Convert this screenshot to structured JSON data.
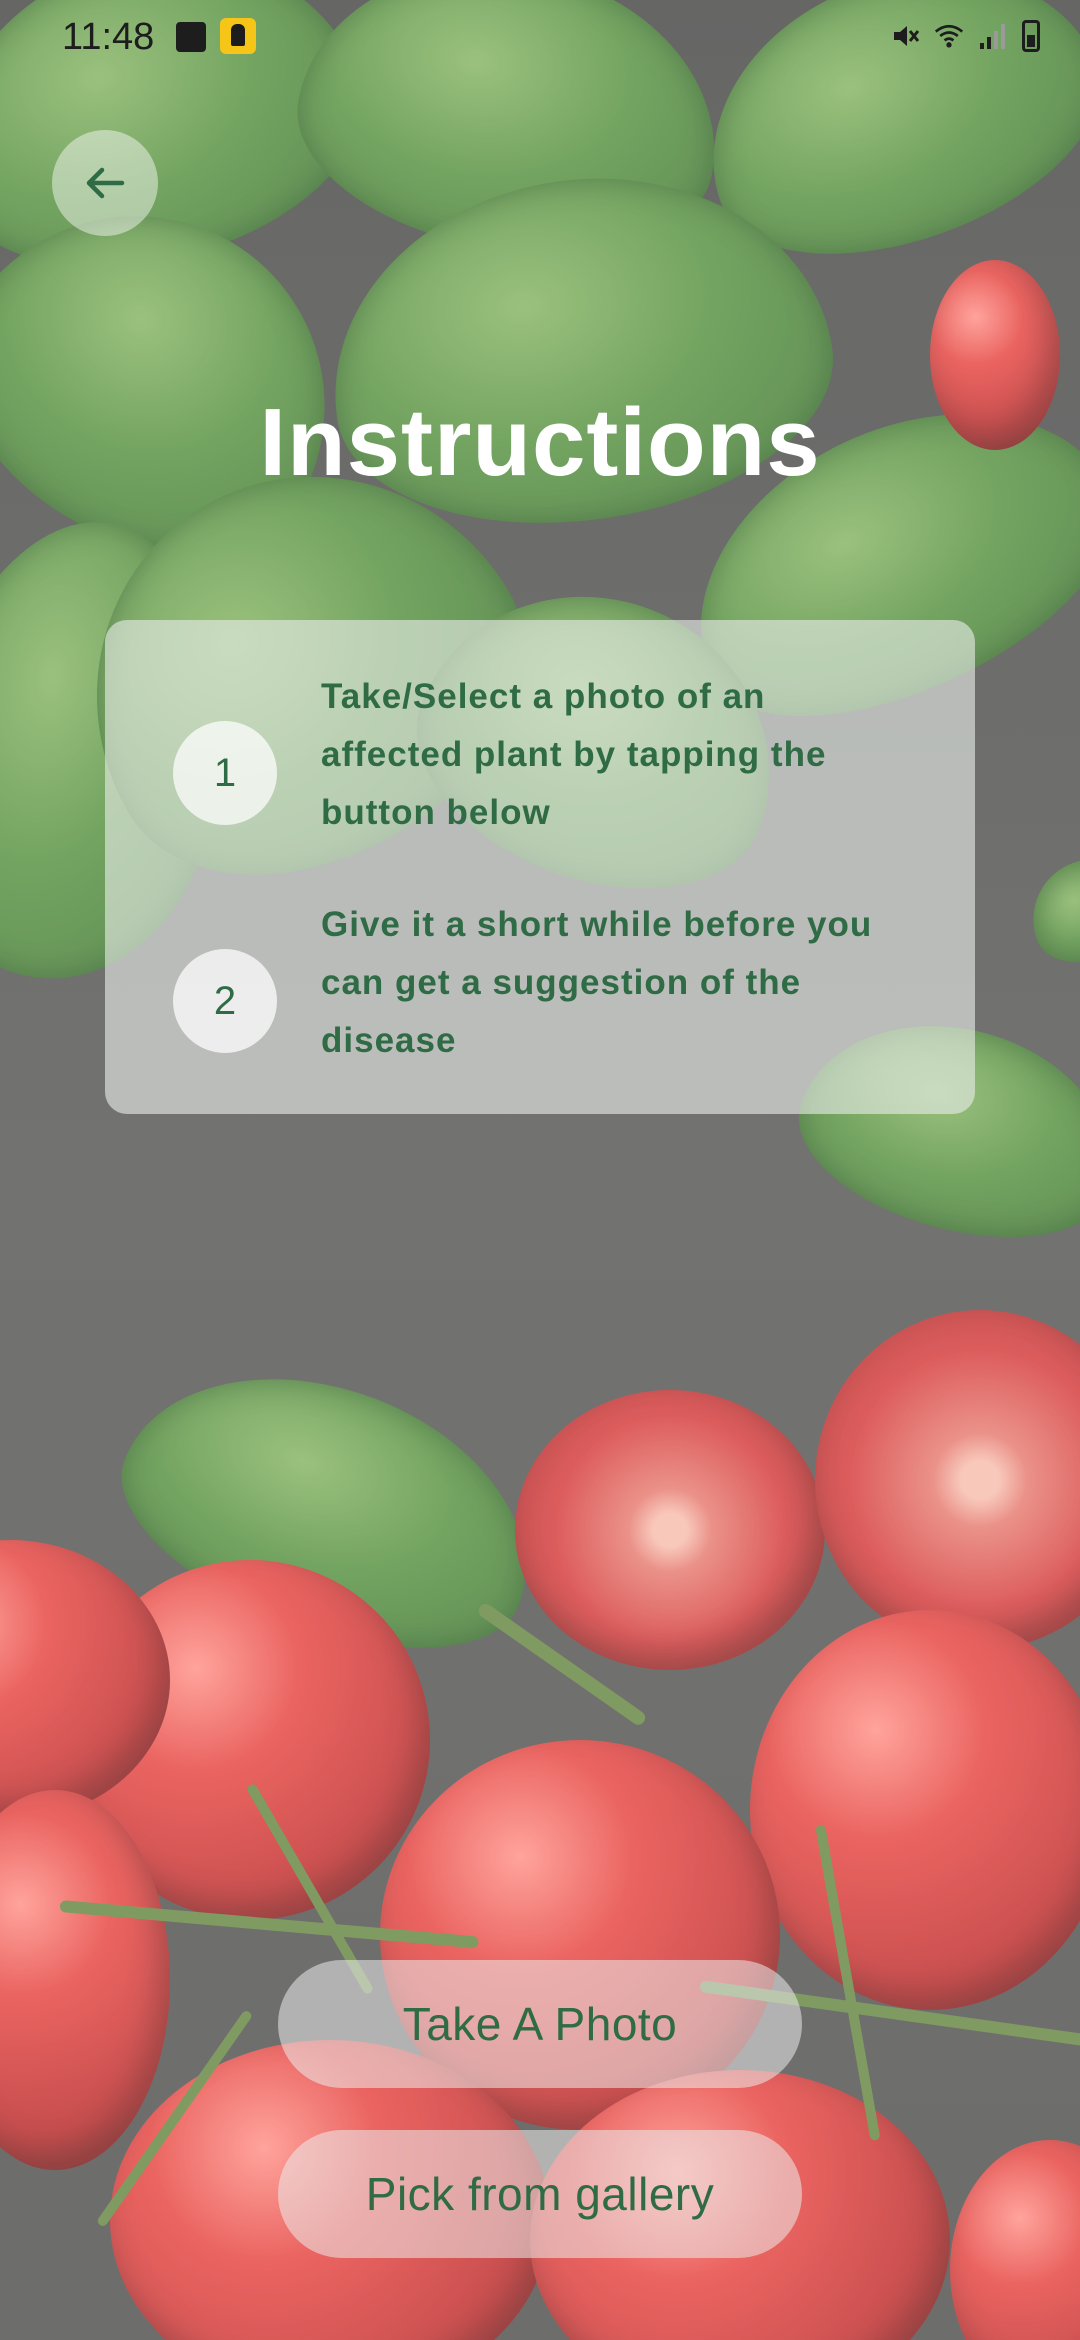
{
  "status_bar": {
    "time": "11:48",
    "icons": [
      "image-icon",
      "accessibility-icon",
      "mute-icon",
      "wifi-icon",
      "signal-icon",
      "battery-icon"
    ]
  },
  "header": {
    "back_icon": "arrow-left-icon",
    "title": "Instructions"
  },
  "instructions": [
    {
      "number": "1",
      "text": "Take/Select a photo of an affected plant by tapping the button below"
    },
    {
      "number": "2",
      "text": "Give it a short while before you can get a suggestion of the disease"
    }
  ],
  "actions": {
    "take_photo": "Take A Photo",
    "pick_gallery": "Pick from gallery"
  },
  "colors": {
    "accent_green": "#2f6b45",
    "title_white": "#ffffff"
  }
}
